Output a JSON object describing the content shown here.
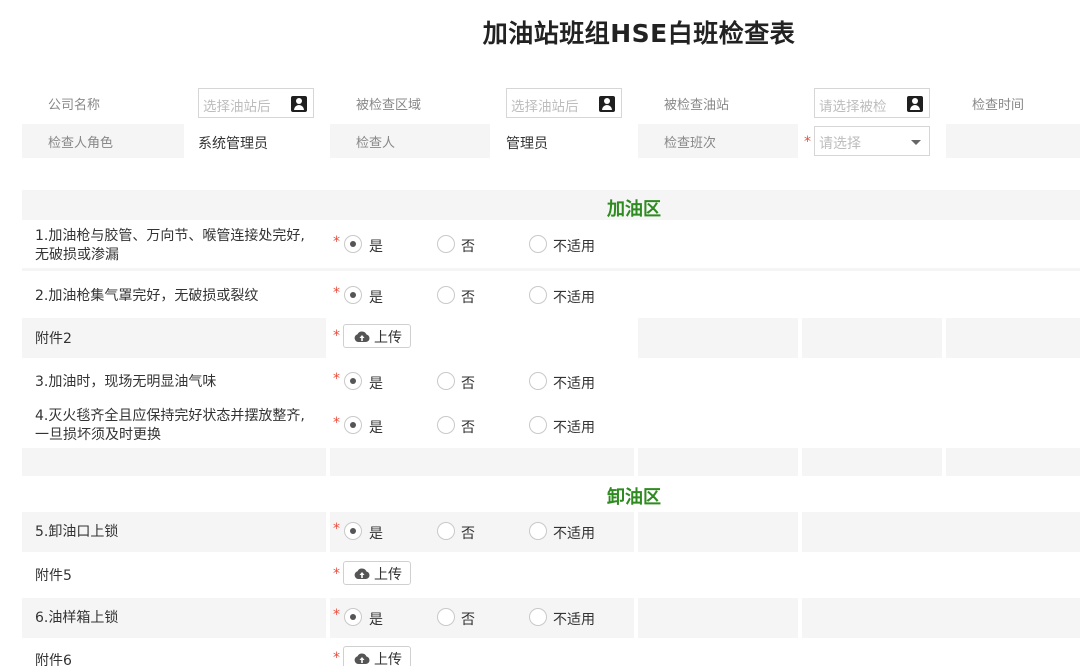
{
  "title": "加油站班组HSE白班检查表",
  "header": {
    "company_label": "公司名称",
    "company_placeholder": "选择油站后",
    "area_label": "被检查区域",
    "area_placeholder": "选择油站后",
    "station_label": "被检查油站",
    "station_placeholder": "请选择被检",
    "time_label": "检查时间",
    "role_label": "检查人角色",
    "role_value": "系统管理员",
    "inspector_label": "检查人",
    "inspector_value": "管理员",
    "shift_label": "检查班次",
    "shift_placeholder": "请选择",
    "required_mark": "*"
  },
  "radio_options": {
    "yes": "是",
    "no": "否",
    "na": "不适用"
  },
  "upload_label": "上传",
  "sections": [
    {
      "title": "加油区",
      "items": [
        {
          "text_line1": "1.加油枪与胶管、万向节、喉管连接处完好,",
          "text_line2": "无破损或渗漏",
          "selected": "是"
        },
        {
          "text_line1": "2.加油枪集气罩完好，无破损或裂纹",
          "selected": "是"
        },
        {
          "text_line1": "附件2",
          "type": "upload"
        },
        {
          "text_line1": "3.加油时，现场无明显油气味",
          "selected": "是"
        },
        {
          "text_line1": "4.灭火毯齐全且应保持完好状态并摆放整齐,",
          "text_line2": "一旦损坏须及时更换",
          "selected": "是"
        }
      ]
    },
    {
      "title": "卸油区",
      "items": [
        {
          "text_line1": "5.卸油口上锁",
          "selected": "是"
        },
        {
          "text_line1": "附件5",
          "type": "upload"
        },
        {
          "text_line1": "6.油样箱上锁",
          "selected": "是"
        },
        {
          "text_line1": "附件6",
          "type": "upload"
        }
      ]
    }
  ],
  "colors": {
    "section_title": "#2e8b1f",
    "required": "#e74c3c",
    "band": "#f5f5f5"
  },
  "icons": {
    "contact": "contact-card-icon",
    "upload": "cloud-upload-icon",
    "select": "chevron-down-icon"
  }
}
